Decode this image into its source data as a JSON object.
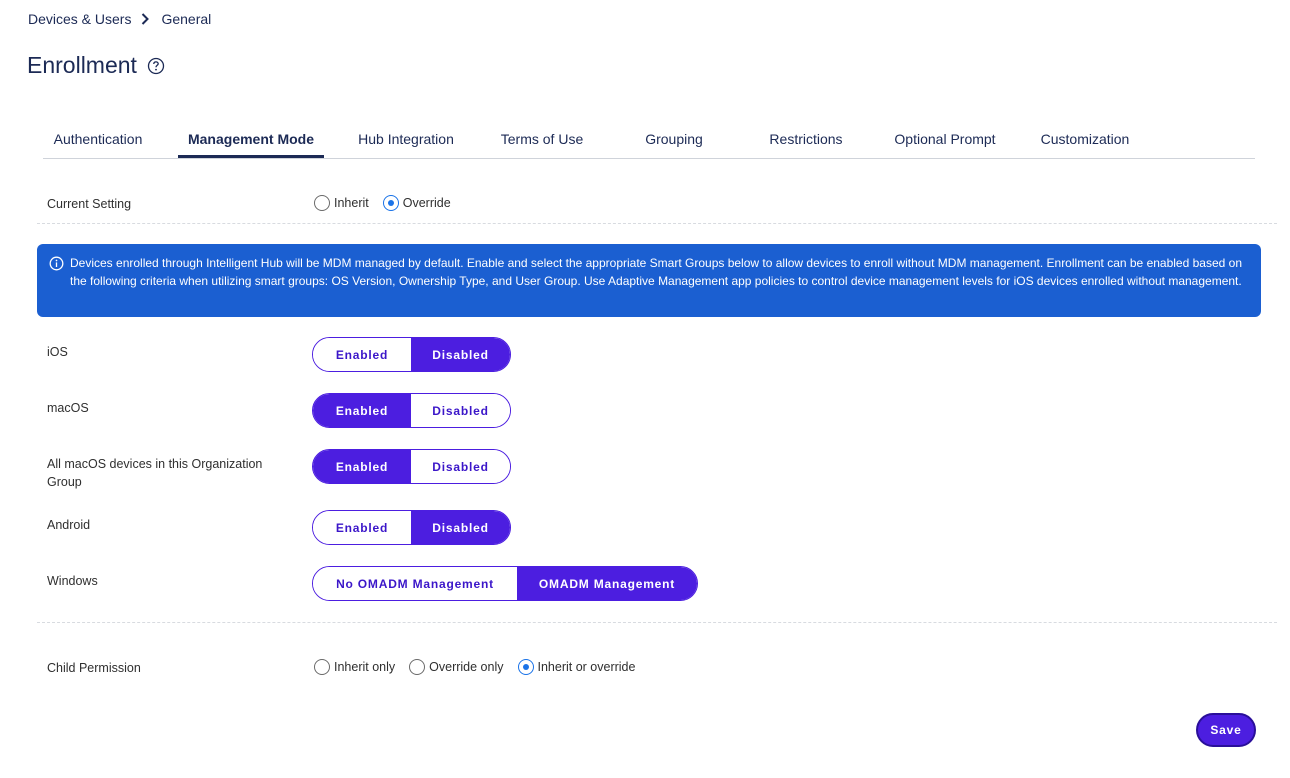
{
  "breadcrumb": {
    "parent": "Devices & Users",
    "current": "General"
  },
  "page": {
    "title": "Enrollment"
  },
  "tabs": [
    {
      "label": "Authentication",
      "active": false
    },
    {
      "label": "Management Mode",
      "active": true
    },
    {
      "label": "Hub Integration",
      "active": false
    },
    {
      "label": "Terms of Use",
      "active": false
    },
    {
      "label": "Grouping",
      "active": false
    },
    {
      "label": "Restrictions",
      "active": false
    },
    {
      "label": "Optional Prompt",
      "active": false
    },
    {
      "label": "Customization",
      "active": false
    }
  ],
  "current_setting": {
    "label": "Current Setting",
    "options": [
      "Inherit",
      "Override"
    ],
    "selected": "Override"
  },
  "info_banner": {
    "text": "Devices enrolled through Intelligent Hub will be MDM managed by default. Enable and select the appropriate Smart Groups below to allow devices to enroll without MDM management. Enrollment can be enabled based on the following criteria when utilizing smart groups: OS Version, Ownership Type, and User Group. Use Adaptive Management app policies to control device management levels for iOS devices enrolled without management."
  },
  "platforms": [
    {
      "label": "iOS",
      "on_label": "Enabled",
      "off_label": "Disabled",
      "value": "Disabled"
    },
    {
      "label": "macOS",
      "on_label": "Enabled",
      "off_label": "Disabled",
      "value": "Enabled"
    },
    {
      "label": "All macOS devices in this Organization Group",
      "on_label": "Enabled",
      "off_label": "Disabled",
      "value": "Enabled"
    },
    {
      "label": "Android",
      "on_label": "Enabled",
      "off_label": "Disabled",
      "value": "Disabled"
    }
  ],
  "windows": {
    "label": "Windows",
    "options": [
      "No OMADM Management",
      "OMADM Management"
    ],
    "value": "OMADM Management"
  },
  "child_permission": {
    "label": "Child Permission",
    "options": [
      "Inherit only",
      "Override only",
      "Inherit or override"
    ],
    "selected": "Inherit or override"
  },
  "actions": {
    "save_label": "Save"
  },
  "colors": {
    "accent": "#4c1ee0",
    "banner": "#1b5fd1",
    "radio": "#1a73e8",
    "nav_text": "#1c2a55"
  }
}
